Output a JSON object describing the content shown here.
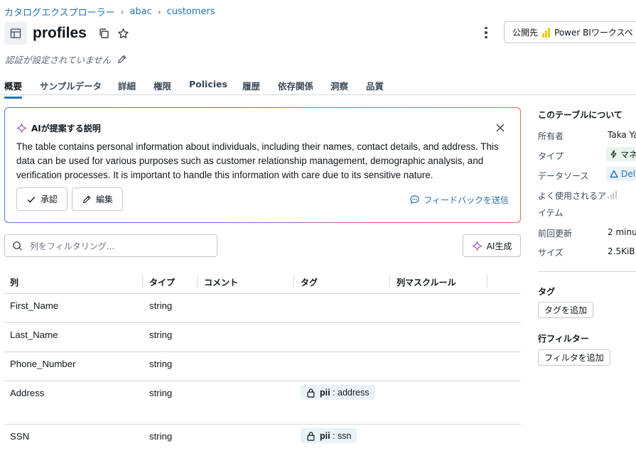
{
  "breadcrumb": {
    "items": [
      "カタログエクスプローラー",
      "abac",
      "customers"
    ],
    "separator": "›"
  },
  "header": {
    "title": "profiles",
    "publish_label": "公開先",
    "powerbi_label": "Power BIワークスペ"
  },
  "auth": {
    "text": "認証が設定されていません"
  },
  "tabs": [
    "概要",
    "サンプルデータ",
    "詳細",
    "権限",
    "Policies",
    "履歴",
    "依存関係",
    "洞察",
    "品質"
  ],
  "active_tab": "概要",
  "ai_card": {
    "title": "AIが提案する説明",
    "description": "The table contains personal information about individuals, including their names, contact details, and address. This data can be used for various purposes such as customer relationship management, demographic analysis, and verification processes. It is important to handle this information with care due to its sensitive nature.",
    "accept_label": "承認",
    "edit_label": "編集",
    "feedback_label": "フィードバックを送信"
  },
  "filter": {
    "placeholder": "列をフィルタリング..."
  },
  "ai_generate_label": "AI生成",
  "columns_table": {
    "headers": [
      "列",
      "タイプ",
      "コメント",
      "タグ",
      "列マスクルール"
    ],
    "rows": [
      {
        "name": "First_Name",
        "type": "string",
        "tag_key": "",
        "tag_value": ""
      },
      {
        "name": "Last_Name",
        "type": "string",
        "tag_key": "",
        "tag_value": ""
      },
      {
        "name": "Phone_Number",
        "type": "string",
        "tag_key": "",
        "tag_value": ""
      },
      {
        "name": "Address",
        "type": "string",
        "tag_key": "pii",
        "tag_value": "address"
      },
      {
        "name": "SSN",
        "type": "string",
        "tag_key": "pii",
        "tag_value": "ssn"
      }
    ]
  },
  "about": {
    "title": "このテーブルについて",
    "owner_label": "所有者",
    "owner_value": "Taka Ya",
    "type_label": "タイプ",
    "type_value": "マネ",
    "source_label": "データソース",
    "source_value": "Del",
    "frequent_label_1": "よく使用されるア",
    "frequent_label_2": "イテム",
    "updated_label": "前回更新",
    "updated_value": "2 minu",
    "size_label": "サイズ",
    "size_value": "2.5KiB"
  },
  "tags_section": {
    "title": "タグ",
    "add_label": "タグを追加"
  },
  "row_filter_section": {
    "title": "行フィルター",
    "add_label": "フィルタを追加"
  },
  "colors": {
    "link": "#2272b4",
    "border": "#d1d9e1",
    "tag_bg": "#e8f3f8",
    "gradient_start": "#4f74e3",
    "gradient_end": "#f06565",
    "powerbi": "#f2c811"
  }
}
